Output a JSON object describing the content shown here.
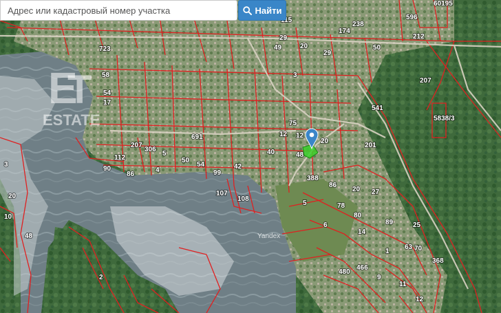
{
  "search": {
    "placeholder": "Адрес или кадастровый номер участка",
    "value": "",
    "button_label": "Найти",
    "button_icon": "search-icon",
    "button_color": "#3a86c8"
  },
  "map": {
    "provider": "Yandex",
    "watermark": "ESTATE",
    "parcel_line_color": "#e02020",
    "selected_parcel_color": "#39d12b",
    "marker_color": "#3a86c8",
    "marker_icon": "map-pin-icon",
    "parcel_numbers": [
      "60195",
      "115",
      "174",
      "238",
      "212",
      "50",
      "12",
      "20",
      "3",
      "29",
      "596",
      "207",
      "541",
      "5838/3",
      "75",
      "12",
      "20",
      "48",
      "42",
      "40",
      "691",
      "388",
      "86",
      "20",
      "27",
      "5",
      "78",
      "80",
      "89",
      "25",
      "6",
      "14",
      "63",
      "1",
      "108",
      "107",
      "99",
      "54",
      "50",
      "5",
      "306",
      "207",
      "112",
      "90",
      "86",
      "4",
      "9",
      "480",
      "466",
      "70",
      "368",
      "11",
      "12",
      "17",
      "2",
      "3",
      "48",
      "54",
      "17",
      "10",
      "20",
      "58",
      "723",
      "49",
      "29",
      "201"
    ]
  }
}
